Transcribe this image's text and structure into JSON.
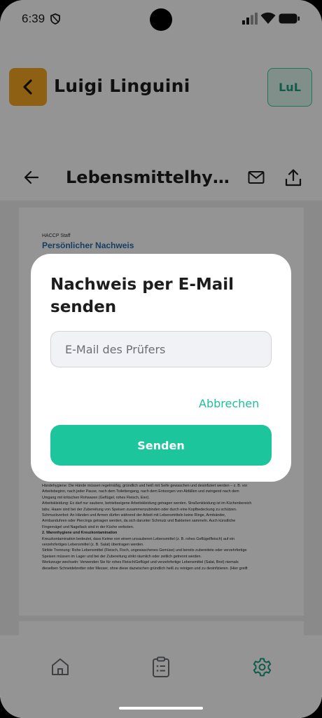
{
  "status_bar": {
    "time": "6:39"
  },
  "header": {
    "user_name": "Luigi Linguini",
    "avatar_initials": "LuL"
  },
  "doc_toolbar": {
    "title": "Lebensmittelhygiene Schulung"
  },
  "document": {
    "kicker": "HACCP Staff",
    "title": "Persönlicher Nachweis",
    "body": [
      "Händehygiene: Die Hände müssen regelmäßig, gründlich und heiß mit Seife gewaschen und desinfiziert werden – z. B. vor",
      "Arbeitsbeginn, nach jeder Pause, nach dem Toilettengang, nach dem Entsorgen von Abfällen und zwingend nach dem",
      "Umgang mit kritischen Rohwaren (Geflügel, rohes Fleisch, Eier).",
      "Arbeitskleidung: Es darf nur saubere, betriebseigene Arbeitskleidung getragen werden. Straßenkleidung ist im Küchenbereich",
      "tabu. Haare sind bei der Zubereitung von Speisen zusammenzubinden oder durch eine Kopfbedeckung zu schützen.",
      "Schmuckverbot: An Händen und Armen dürfen während der Arbeit mit Lebensmitteln keine Ringe, Armbänder,",
      "Armbanduhren oder Piercings getragen werden, da sich darunter Schmutz und Bakterien sammeln. Auch künstliche",
      "Fingernägel und Nagellack sind in der Küche verboten."
    ],
    "heading2": "2. Warenhygiene und Kreuzkontamination",
    "body2": [
      "Kreuzkontamination bedeutet, dass Keime von einem unsauberen Lebensmittel (z. B. rohes Geflügelfleisch) auf ein",
      "verzehrfertiges Lebensmittel (z. B. Salat) übertragen werden.",
      "Strikte Trennung: Rohe Lebensmittel (Fleisch, Fisch, ungewaschenes Gemüse) und bereits zubereitete oder verzehrfertige",
      "Speisen müssen im Lager und bei der Zubereitung strikt räumlich oder zeitlich getrennt werden.",
      "Werkzeuge wechseln: Verwenden Sie für rohes Fleisch/Geflügel und verzehrfertige Lebensmittel (Salat, Brot) niemals",
      "dieselben Schneidebretter oder Messer, ohne diese dazwischen gründlich heiß zu reinigen und zu desinfizieren. (Hier greift"
    ]
  },
  "dialog": {
    "title": "Nachweis per E-Mail senden",
    "email_placeholder": "E-Mail des Prüfers",
    "cancel_label": "Abbrechen",
    "send_label": "Senden"
  },
  "colors": {
    "accent": "#1cc59c",
    "back_button": "#f5a623"
  }
}
